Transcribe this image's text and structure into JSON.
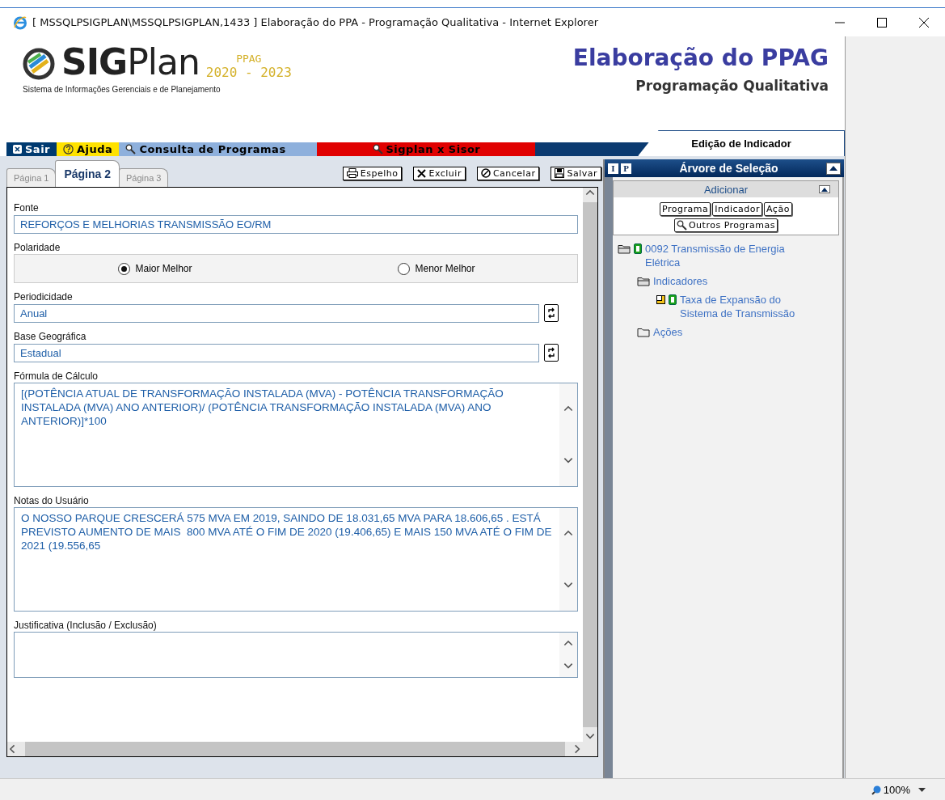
{
  "window": {
    "title": "[ MSSQLPSIGPLAN\\MSSQLPSIGPLAN,1433 ]  Elaboração do PPA - Programação Qualitativa - Internet Explorer"
  },
  "header": {
    "logo": "**SIG**Plan",
    "edition": "PPAG",
    "years": "2020 - 2023",
    "tagline": "Sistema de Informações Gerenciais e de Planejamento",
    "title": "Elaboração do PPAG",
    "subtitle": "Programação Qualitativa"
  },
  "menu": [
    {
      "label": "Sair",
      "kind": "exit",
      "color": "#003a70"
    },
    {
      "label": "Ajuda",
      "kind": "help",
      "color": "#ffe200"
    },
    {
      "label": "Consulta de Programas",
      "kind": "search",
      "color": "#8eb0dc"
    },
    {
      "label": "Sigplan x Sisor",
      "kind": "search",
      "color": "#e00000"
    }
  ],
  "section_tab": "Edição de Indicador",
  "page_tabs": [
    {
      "label": "Página 1",
      "selected": false
    },
    {
      "label": "Página 2",
      "selected": true
    },
    {
      "label": "Página 3",
      "selected": false
    }
  ],
  "toolbar": [
    {
      "label": "Espelho",
      "kind": "print"
    },
    {
      "label": "Excluir",
      "kind": "delete"
    },
    {
      "label": "Cancelar",
      "kind": "cancel"
    },
    {
      "label": "Salvar",
      "kind": "save"
    }
  ],
  "fields": [
    {
      "kind": "text",
      "label": "Fonte",
      "value": "REFORÇOS E MELHORIAS TRANSMISSÃO EO/RM"
    },
    {
      "kind": "radio",
      "label": "Polaridade",
      "options": [
        {
          "label": "Maior Melhor",
          "selected": true
        },
        {
          "label": "Menor Melhor",
          "selected": false
        }
      ]
    },
    {
      "kind": "select",
      "label": "Periodicidade",
      "value": "Anual"
    },
    {
      "kind": "select",
      "label": "Base Geográfica",
      "value": "Estadual"
    },
    {
      "kind": "textarea",
      "label": "Fórmula de Cálculo",
      "value": "[(POTÊNCIA ATUAL DE TRANSFORMAÇÃO INSTALADA (MVA) - POTÊNCIA TRANSFORMAÇÃO INSTALADA (MVA) ANO ANTERIOR)/ (POTÊNCIA TRANSFORMAÇÃO INSTALADA (MVA) ANO ANTERIOR)]*100"
    },
    {
      "kind": "textarea",
      "label": "Notas do Usuário",
      "value": "O NOSSO PARQUE CRESCERÁ 575 MVA EM 2019, SAINDO DE 18.031,65 MVA PARA 18.606,65 . ESTÁ PREVISTO AUMENTO DE MAIS  800 MVA ATÉ O FIM DE 2020 (19.406,65) E MAIS 150 MVA ATÉ O FIM DE 2021 (19.556,65"
    },
    {
      "kind": "short-textarea",
      "label": "Justificativa (Inclusão / Exclusão)"
    }
  ],
  "tree_panel": {
    "icons": [
      "I",
      "P"
    ],
    "title": "Árvore de Seleção",
    "add_title": "Adicionar",
    "add_buttons": [
      "Programa",
      "Indicador",
      "Ação"
    ],
    "search_button": "Outros Programas",
    "tree": [
      {
        "kind": "program",
        "label": "0092 Transmissão de Energia Elétrica",
        "children": [
          {
            "kind": "open-folder",
            "label": "Indicadores",
            "children": [
              {
                "kind": "indicator",
                "label": "Taxa de Expansão do Sistema de Transmissão"
              }
            ]
          },
          {
            "kind": "folder",
            "label": "Ações"
          }
        ]
      }
    ]
  },
  "status_bar": {
    "zoom": "100%"
  }
}
